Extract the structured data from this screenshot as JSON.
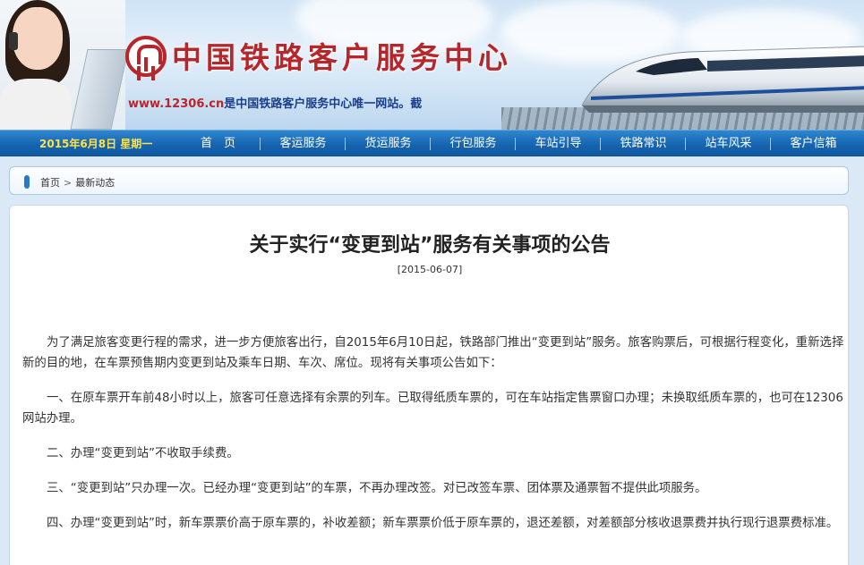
{
  "header": {
    "site_title": "中国铁路客户服务中心",
    "site_url": "www.12306.cn",
    "site_tagline": "是中国铁路客户服务中心唯一网站。截"
  },
  "navbar": {
    "date": "2015年6月8日 星期一",
    "items": [
      {
        "label": "首　页"
      },
      {
        "label": "客运服务"
      },
      {
        "label": "货运服务"
      },
      {
        "label": "行包服务"
      },
      {
        "label": "车站引导"
      },
      {
        "label": "铁路常识"
      },
      {
        "label": "站车风采"
      },
      {
        "label": "客户信箱"
      }
    ]
  },
  "breadcrumb": {
    "home": "首页",
    "separator": ">",
    "current": "最新动态"
  },
  "article": {
    "title": "关于实行“变更到站”服务有关事项的公告",
    "date": "[2015-06-07]",
    "paragraphs": [
      "为了满足旅客变更行程的需求，进一步方便旅客出行，自2015年6月10日起，铁路部门推出“变更到站”服务。旅客购票后，可根据行程变化，重新选择新的目的地，在车票预售期内变更到站及乘车日期、车次、席位。现将有关事项公告如下：",
      "一、在原车票开车前48小时以上，旅客可任意选择有余票的列车。已取得纸质车票的，可在车站指定售票窗口办理；未换取纸质车票的，也可在12306网站办理。",
      "二、办理“变更到站”不收取手续费。",
      "三、“变更到站”只办理一次。已经办理“变更到站”的车票，不再办理改签。对已改签车票、团体票及通票暂不提供此项服务。",
      "四、办理“变更到站”时，新车票票价高于原车票的，补收差额；新车票票价低于原车票的，退还差额，对差额部分核收退票费并执行现行退票费标准。"
    ]
  },
  "colors": {
    "brand_red": "#b7262a",
    "nav_blue": "#1665b0",
    "date_yellow": "#ffe14a"
  }
}
